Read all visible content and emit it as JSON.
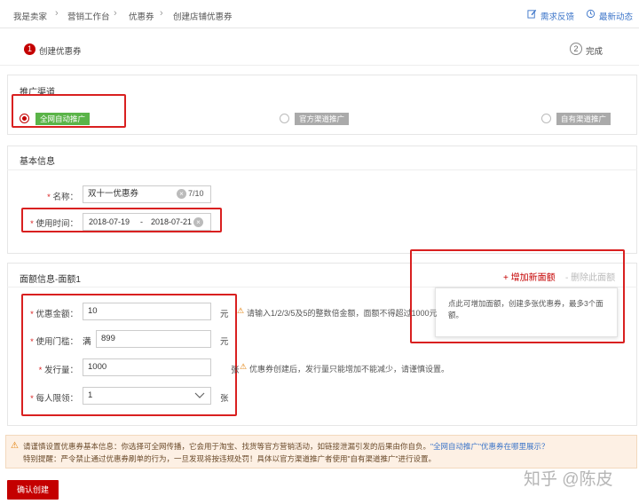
{
  "breadcrumb": {
    "items": [
      "我是卖家",
      "营销工作台",
      "优惠券",
      "创建店铺优惠券"
    ]
  },
  "toplinks": {
    "feedback": "需求反馈",
    "updates": "最新动态"
  },
  "steps": [
    {
      "num": "1",
      "label": "创建优惠券"
    },
    {
      "num": "2",
      "label": "完成"
    }
  ],
  "channel": {
    "title": "推广渠道",
    "options": [
      {
        "label": "全网自动推广",
        "checked": true
      },
      {
        "label": "官方渠道推广",
        "checked": false
      },
      {
        "label": "自有渠道推广",
        "checked": false
      }
    ]
  },
  "basic": {
    "title": "基本信息",
    "name_label": "名称：",
    "name_value": "双十一优惠券",
    "name_count": "7/10",
    "time_label": "使用时间：",
    "time_start": "2018-07-19",
    "time_sep": "-",
    "time_end": "2018-07-21"
  },
  "face": {
    "title": "面额信息-面额1",
    "add_label": "+ 增加新面额",
    "delete_label": "- 删除此面额",
    "tooltip": "点此可增加面额，创建多张优惠券，最多3个面额。",
    "amount_label": "优惠金额：",
    "amount_value": "10",
    "amount_unit": "元",
    "amount_hint": "请输入1/2/3/5及5的整数倍金额，面额不得超过1000元",
    "threshold_label": "使用门槛：",
    "threshold_prefix": "满",
    "threshold_value": "899",
    "threshold_unit": "元",
    "issue_label": "发行量：",
    "issue_value": "1000",
    "issue_unit": "张",
    "issue_hint": "优惠券创建后，发行量只能增加不能减少，请谨慎设置。",
    "limit_label": "每人限领：",
    "limit_value": "1",
    "limit_unit": "张"
  },
  "notice": {
    "line1": "请谨慎设置优惠券基本信息：你选择可全网传播，它会用于淘宝、找货等官方营销活动，如链接泄漏引发的后果由你自负。",
    "link": "\"全网自动推广\"优惠券在哪里展示？",
    "line2": "特别提醒：严令禁止通过优惠券刷单的行为，一旦发现将按违规处罚！具体以官方渠道推广者使用\"自有渠道推广\"进行设置。"
  },
  "submit_label": "确认创建",
  "watermark": "知乎 @陈皮",
  "colors": {
    "brand_red": "#c40000",
    "highlight_red": "#d92020",
    "link_blue": "#3c75c9",
    "chip_green": "#5ab448",
    "notice_bg": "#fdf0e4"
  }
}
